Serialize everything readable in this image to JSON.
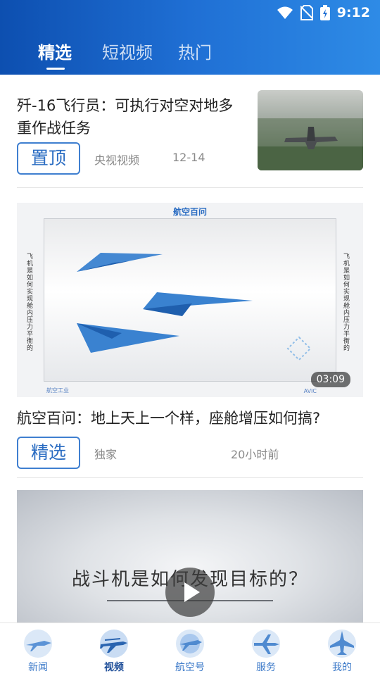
{
  "status_bar": {
    "time": "9:12"
  },
  "tabs": [
    {
      "label": "精选",
      "active": true
    },
    {
      "label": "短视频",
      "active": false
    },
    {
      "label": "热门",
      "active": false
    }
  ],
  "feed": {
    "article1": {
      "title": "歼-16飞行员：可执行对空对地多重作战任务",
      "tag": "置顶",
      "source": "央视视频",
      "date": "12-14"
    },
    "video1": {
      "banner": "航空百问",
      "side_text": "飞机是如何实现舱内压力平衡的",
      "footer_left": "航空工业",
      "footer_right": "AVIC",
      "duration": "03:09"
    },
    "article2": {
      "title": "航空百问：地上天上一个样，座舱增压如何搞?",
      "tag": "精选",
      "source": "独家",
      "date": "20小时前"
    },
    "video2": {
      "caption": "战斗机是如何发现目标的？"
    }
  },
  "bottom_nav": [
    {
      "label": "新闻",
      "icon": "fighter-jet-icon",
      "active": false
    },
    {
      "label": "视频",
      "icon": "airliner-icon",
      "active": true
    },
    {
      "label": "航空号",
      "icon": "plane-globe-icon",
      "active": false
    },
    {
      "label": "服务",
      "icon": "airliner-icon",
      "active": false
    },
    {
      "label": "我的",
      "icon": "fighter-jet-icon",
      "active": false
    }
  ],
  "colors": {
    "accent": "#1f6fd4",
    "tag_border": "#3f7fd0"
  }
}
